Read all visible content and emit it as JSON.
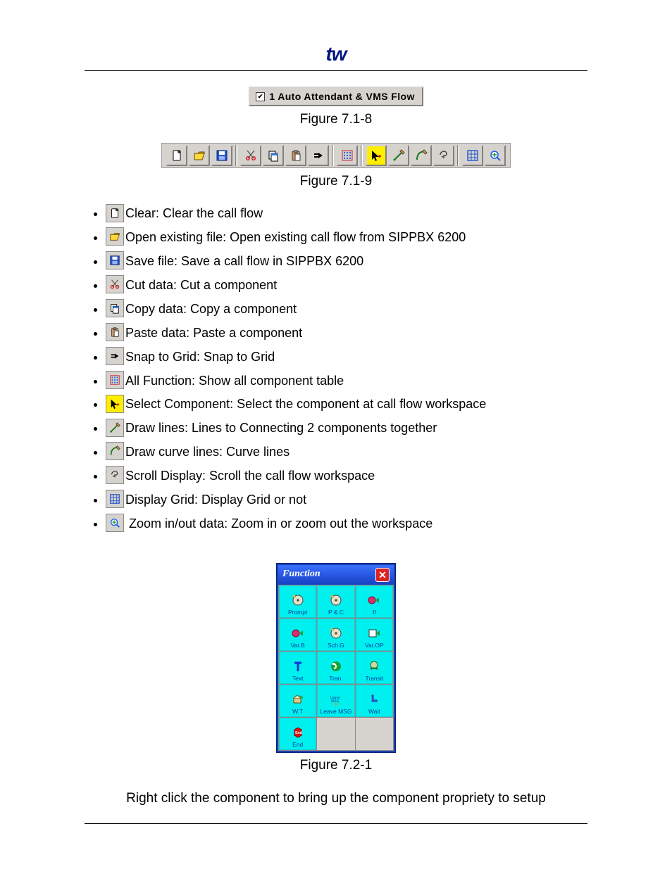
{
  "logo_text": "tw",
  "tab": {
    "label": "1 Auto Attendant & VMS Flow",
    "checked": true
  },
  "captions": {
    "fig_7_1_8": "Figure 7.1-8",
    "fig_7_1_9": "Figure 7.1-9",
    "fig_7_2_1": "Figure 7.2-1"
  },
  "toolbar_groups": [
    [
      "clear",
      "open",
      "save"
    ],
    [
      "cut",
      "copy",
      "paste",
      "snap"
    ],
    [
      "allfunc"
    ],
    [
      "select",
      "drawline",
      "drawcurve",
      "scroll"
    ],
    [
      "grid",
      "zoom"
    ]
  ],
  "toolbar_selected": "select",
  "bullets": [
    {
      "icon": "clear",
      "text": "Clear: Clear the call flow"
    },
    {
      "icon": "open",
      "text": "Open existing file: Open existing call flow from SIPPBX 6200"
    },
    {
      "icon": "save",
      "text": "Save file: Save a call flow in SIPPBX 6200"
    },
    {
      "icon": "cut",
      "text": "Cut data: Cut a component"
    },
    {
      "icon": "copy",
      "text": "Copy data: Copy a component"
    },
    {
      "icon": "paste",
      "text": "Paste data: Paste a component"
    },
    {
      "icon": "snap",
      "text": "Snap to Grid: Snap to Grid"
    },
    {
      "icon": "allfunc",
      "text": "All Function: Show all component table"
    },
    {
      "icon": "select",
      "text": "Select Component: Select the component at call flow workspace"
    },
    {
      "icon": "drawline",
      "text": "Draw lines: Lines to Connecting 2 components together"
    },
    {
      "icon": "drawcurve",
      "text": "Draw curve lines: Curve lines"
    },
    {
      "icon": "scroll",
      "text": "Scroll Display: Scroll the call flow workspace"
    },
    {
      "icon": "grid",
      "text": "Display Grid: Display Grid or not"
    },
    {
      "icon": "zoom",
      "text": " Zoom in/out data: Zoom in or zoom out the workspace"
    }
  ],
  "function_window": {
    "title": "Function",
    "close": "✕",
    "cells": [
      {
        "label": "Prompt"
      },
      {
        "label": "P & C"
      },
      {
        "label": "If"
      },
      {
        "label": "Var.B"
      },
      {
        "label": "Sch.G"
      },
      {
        "label": "Var.OP"
      },
      {
        "label": "Text"
      },
      {
        "label": "Tran."
      },
      {
        "label": "Transit"
      },
      {
        "label": "W.T"
      },
      {
        "label": "Leave MSG"
      },
      {
        "label": "Wait"
      },
      {
        "label": "End"
      },
      {
        "empty": true
      },
      {
        "empty": true
      }
    ]
  },
  "footer_text": "Right click the component to bring up the component propriety to setup"
}
